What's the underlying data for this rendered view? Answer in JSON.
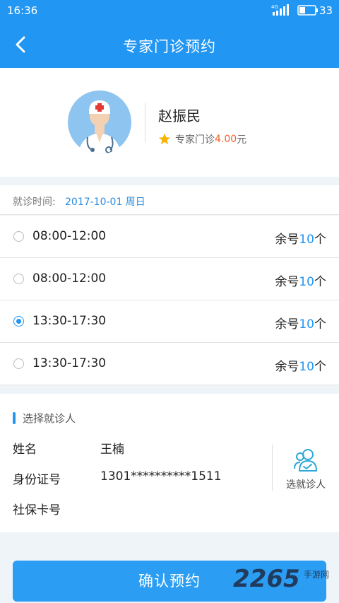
{
  "status_bar": {
    "time": "16:36",
    "network": "4G",
    "battery": "33"
  },
  "nav": {
    "title": "专家门诊预约"
  },
  "doctor": {
    "name": "赵振民",
    "clinic_type": "专家门诊",
    "price": "4.00",
    "currency": "元"
  },
  "visit_date": {
    "label": "就诊时间:",
    "value": "2017-10-01  周日"
  },
  "slots": [
    {
      "time": "08:00-12:00",
      "remain_prefix": "余号",
      "remain_count": "10",
      "remain_suffix": "个",
      "selected": false
    },
    {
      "time": "08:00-12:00",
      "remain_prefix": "余号",
      "remain_count": "10",
      "remain_suffix": "个",
      "selected": false
    },
    {
      "time": "13:30-17:30",
      "remain_prefix": "余号",
      "remain_count": "10",
      "remain_suffix": "个",
      "selected": true
    },
    {
      "time": "13:30-17:30",
      "remain_prefix": "余号",
      "remain_count": "10",
      "remain_suffix": "个",
      "selected": false
    }
  ],
  "patient": {
    "section_title": "选择就诊人",
    "name_label": "姓名",
    "name_value": "王楠",
    "id_label": "身份证号",
    "id_value": "1301**********1511",
    "social_label": "社保卡号",
    "social_value": "",
    "pick_label": "选就诊人"
  },
  "confirm": {
    "label": "确认预约"
  },
  "watermark": {
    "brand": "2265",
    "site": "手游网"
  },
  "colors": {
    "primary": "#2196f3",
    "price": "#f0642e",
    "background": "#eef4f8"
  },
  "icons": {
    "back": "chevron-left-icon",
    "star": "star-icon",
    "patient": "users-check-icon",
    "avatar": "doctor-avatar"
  }
}
